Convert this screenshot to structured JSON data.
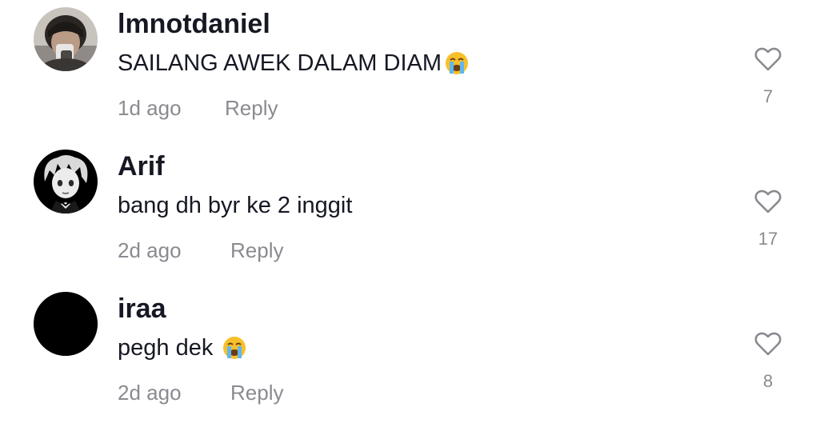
{
  "comments": [
    {
      "username": "lmnotdaniel",
      "text": "SAILANG AWEK DALAM DIAM",
      "emoji": "loudly-crying-face",
      "time": "1d ago",
      "reply_label": "Reply",
      "likes": "7",
      "avatar": "photo-avatar"
    },
    {
      "username": "Arif",
      "text": "bang dh byr ke 2 inggit",
      "time": "2d ago",
      "reply_label": "Reply",
      "likes": "17",
      "avatar": "anime-avatar"
    },
    {
      "username": "iraa",
      "text": "pegh dek ",
      "emoji": "loudly-crying-face",
      "time": "2d ago",
      "reply_label": "Reply",
      "likes": "8",
      "avatar": "black-avatar"
    }
  ],
  "colors": {
    "text_primary": "#161823",
    "text_secondary": "#8a8b91",
    "background": "#ffffff"
  }
}
